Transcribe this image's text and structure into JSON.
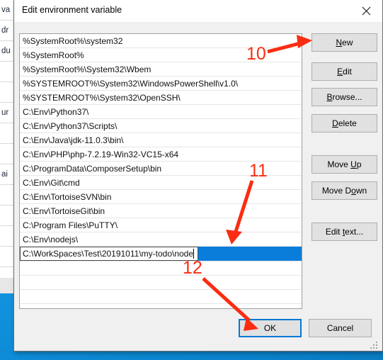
{
  "window": {
    "title": "Edit environment variable",
    "close_icon": "close-icon"
  },
  "path_list": {
    "entries": [
      "%SystemRoot%\\system32",
      "%SystemRoot%",
      "%SystemRoot%\\System32\\Wbem",
      "%SYSTEMROOT%\\System32\\WindowsPowerShell\\v1.0\\",
      "%SYSTEMROOT%\\System32\\OpenSSH\\",
      "C:\\Env\\Python37\\",
      "C:\\Env\\Python37\\Scripts\\",
      "C:\\Env\\Java\\jdk-11.0.3\\bin\\",
      "C:\\Env\\PHP\\php-7.2.19-Win32-VC15-x64",
      "C:\\ProgramData\\ComposerSetup\\bin",
      "C:\\Env\\Git\\cmd",
      "C:\\Env\\TortoiseSVN\\bin",
      "C:\\Env\\TortoiseGit\\bin",
      "C:\\Program Files\\PuTTY\\",
      "C:\\Env\\nodejs\\"
    ],
    "editing_row": {
      "value": "C:\\WorkSpaces\\Test\\20191011\\my-todo\\node",
      "selected": true,
      "highlight_color": "#0a7ddb"
    },
    "empty_rows": 5
  },
  "side_buttons": [
    {
      "label": "New",
      "accel": "N",
      "before": "",
      "after": "ew"
    },
    {
      "label": "Edit",
      "accel": "E",
      "before": "",
      "after": "dit"
    },
    {
      "label": "Browse...",
      "accel": "B",
      "before": "",
      "after": "rowse..."
    },
    {
      "label": "Delete",
      "accel": "D",
      "before": "",
      "after": "elete"
    },
    {
      "label": "Move Up",
      "accel": "U",
      "before": "Move ",
      "after": "p"
    },
    {
      "label": "Move Down",
      "accel": "o",
      "before": "Move D",
      "after": "wn"
    },
    {
      "label": "Edit text...",
      "accel": "t",
      "before": "Edit ",
      "after": "ext..."
    }
  ],
  "footer": {
    "ok_label": "OK",
    "cancel_label": "Cancel",
    "ok_focused": true
  },
  "annotations": [
    {
      "number": "10",
      "target": "new-button"
    },
    {
      "number": "11",
      "target": "editing-row"
    },
    {
      "number": "12",
      "target": "ok-button"
    }
  ],
  "colors": {
    "accent": "#0078d7",
    "selection": "#0a7ddb",
    "annotation": "#fa2d12",
    "dialog_bg": "#f0f0f0",
    "button_bg": "#e1e1e1",
    "desktop": "#0a8fd8"
  },
  "background_window": {
    "fragments": [
      "va",
      "dr",
      "du",
      "ur",
      "ai"
    ]
  }
}
